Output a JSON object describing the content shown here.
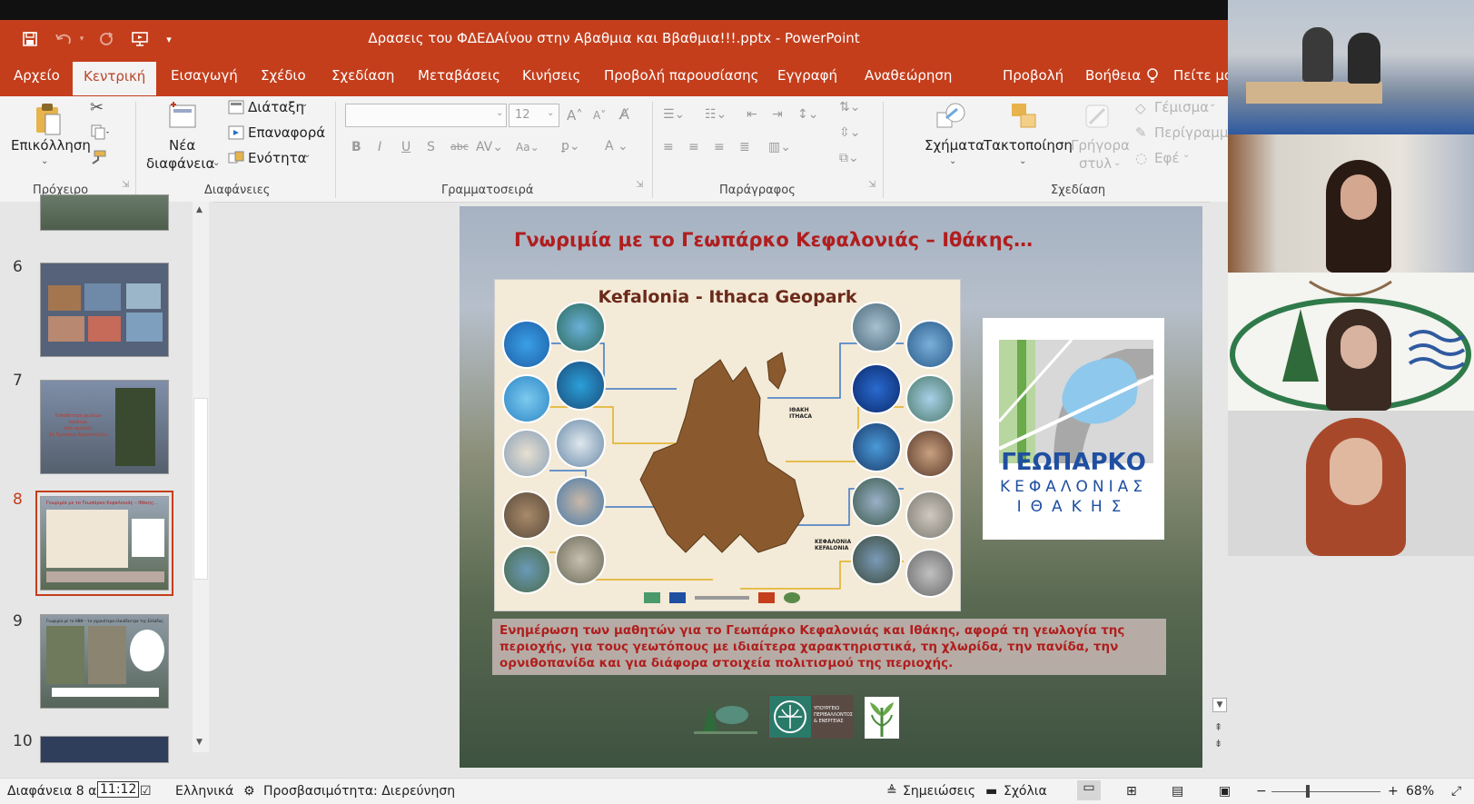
{
  "app": {
    "title": "Δρασεις του ΦΔΕΔΑίνου στην Αβαθμια και Ββαθμια!!!.pptx  -  PowerPoint"
  },
  "tabs": [
    "Αρχείο",
    "Κεντρική",
    "Εισαγωγή",
    "Σχέδιο",
    "Σχεδίαση",
    "Μεταβάσεις",
    "Κινήσεις",
    "Προβολή παρουσίασης",
    "Εγγραφή",
    "Αναθεώρηση",
    "Προβολή",
    "Βοήθεια"
  ],
  "tell_me": "Πείτε μο",
  "ribbon": {
    "clipboard": {
      "paste": "Επικόλληση",
      "label": "Πρόχειρο"
    },
    "slides": {
      "new_slide_1": "Νέα",
      "new_slide_2": "διαφάνεια",
      "layout": "Διάταξη",
      "reset": "Επαναφορά",
      "section": "Ενότητα",
      "label": "Διαφάνειες"
    },
    "font": {
      "name_value": "",
      "size_value": "12",
      "label": "Γραμματοσειρά"
    },
    "paragraph": {
      "label": "Παράγραφος"
    },
    "drawing": {
      "shapes": "Σχήματα",
      "arrange": "Τακτοποίηση",
      "quick_styles_1": "Γρήγορα",
      "quick_styles_2": "στυλ",
      "fill": "Γέμισμα",
      "outline": "Περίγραμμα",
      "effects": "Εφέ",
      "label": "Σχεδίαση"
    }
  },
  "thumbnails": [
    {
      "number": "6"
    },
    {
      "number": "7",
      "caption_1": "Τοποθέτηση φωλιών πουλιών",
      "caption_2": "στο σχολείο",
      "caption_3": "2ο Γυμνάσιο Αργοστολίου"
    },
    {
      "number": "8",
      "caption_1": "Γνωριμία με το Γεωπάρκο Κεφαλονιάς – Ιθάκης…"
    },
    {
      "number": "9",
      "caption_1": "Γνωριμία με το ΗΒΦ – τα γηραιότερα ελαιόδεντρα της Ελλάδας"
    },
    {
      "number": "10"
    }
  ],
  "slide": {
    "title": "Γνωριμία με το Γεωπάρκο Κεφαλονιάς – Ιθάκης…",
    "map_title": "Kefalonia - Ithaca Geopark",
    "ithaca_label_1": "ΙΘΑΚΗ",
    "ithaca_label_2": "ITHACA",
    "kefalonia_label_1": "ΚΕΦΑΛΟΝΙΑ",
    "kefalonia_label_2": "KEFALONIA",
    "logo_line1": "ΓΕΩΠΑΡΚΟ",
    "logo_line2": "ΚΕΦΑΛΟΝΙΑΣ",
    "logo_line3": "ΙΘΑΚΗΣ",
    "body": "Ενημέρωση των μαθητών για το Γεωπάρκο Κεφαλονιάς και Ιθάκης, αφορά τη γεωλογία της περιοχής, για τους γεωτόπους με ιδιαίτερα χαρακτηριστικά, τη χλωρίδα, την πανίδα, την ορνιθοπανίδα και για διάφορα στοιχεία πολιτισμού της περιοχής.",
    "ministry_1": "ΥΠΟΥΡΓΕΙΟ",
    "ministry_2": "ΠΕΡΙΒΑΛΛΟΝΤΟΣ",
    "ministry_3": "& ΕΝΕΡΓΕΙΑΣ"
  },
  "status": {
    "slide_info": "Διαφάνεια 8 από",
    "time": "11:12",
    "language": "Ελληνικά",
    "accessibility": "Προσβασιμότητα: Διερεύνηση",
    "notes": "Σημειώσεις",
    "comments": "Σχόλια",
    "zoom": "68%"
  },
  "colors": {
    "accent": "#c43e1c",
    "slide_title": "#b01e1e",
    "logo_blue": "#1f4fa0"
  }
}
